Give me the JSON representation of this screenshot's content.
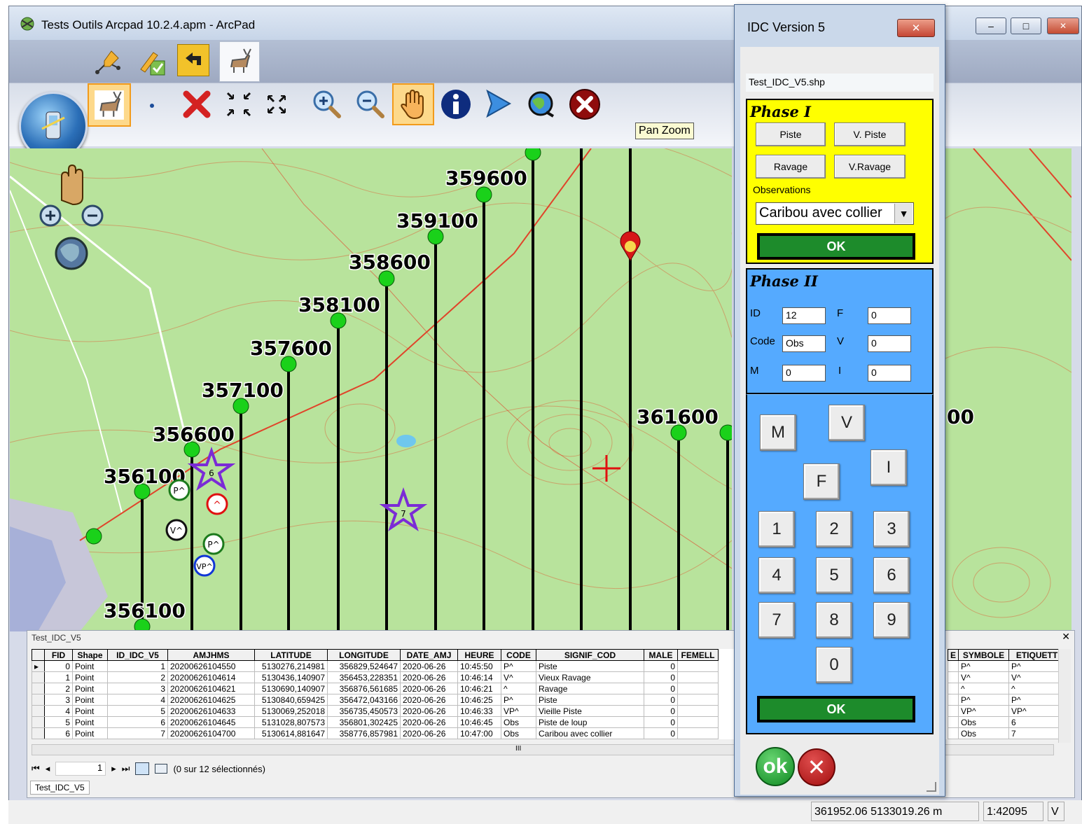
{
  "window": {
    "title": "Tests Outils Arcpad 10.2.4.apm - ArcPad",
    "minimize": "–",
    "maximize": "□",
    "close": "✕"
  },
  "toolbar": {
    "tooltip": "Pan Zoom",
    "active_tool_icon": "hand-pan-icon"
  },
  "map": {
    "grid_labels": [
      "359600",
      "359100",
      "358600",
      "358100",
      "357600",
      "357100",
      "356600",
      "356100",
      "356100",
      "361600",
      "00"
    ],
    "markers": [
      "P^",
      "^",
      "V^",
      "P^",
      "VP^",
      "6",
      "7"
    ]
  },
  "attribute_table": {
    "layer_name": "Test_IDC_V5",
    "close_label": "✕",
    "columns": [
      "FID",
      "Shape",
      "ID_IDC_V5",
      "AMJHMS",
      "LATITUDE",
      "LONGITUDE",
      "DATE_AMJ",
      "HEURE",
      "CODE",
      "SIGNIF_COD",
      "MALE",
      "FEMELL"
    ],
    "right_columns": [
      "E",
      "SYMBOLE",
      "ETIQUETT"
    ],
    "rows": [
      [
        "0",
        "Point",
        "1",
        "20200626104550",
        "5130276,214981",
        "356829,524647",
        "2020-06-26",
        "10:45:50",
        "P^",
        "Piste",
        "0",
        ""
      ],
      [
        "1",
        "Point",
        "2",
        "20200626104614",
        "5130436,140907",
        "356453,228351",
        "2020-06-26",
        "10:46:14",
        "V^",
        "Vieux Ravage",
        "0",
        ""
      ],
      [
        "2",
        "Point",
        "3",
        "20200626104621",
        "5130690,140907",
        "356876,561685",
        "2020-06-26",
        "10:46:21",
        "^",
        "Ravage",
        "0",
        ""
      ],
      [
        "3",
        "Point",
        "4",
        "20200626104625",
        "5130840,659425",
        "356472,043166",
        "2020-06-26",
        "10:46:25",
        "P^",
        "Piste",
        "0",
        ""
      ],
      [
        "4",
        "Point",
        "5",
        "20200626104633",
        "5130069,252018",
        "356735,450573",
        "2020-06-26",
        "10:46:33",
        "VP^",
        "Vieille Piste",
        "0",
        ""
      ],
      [
        "5",
        "Point",
        "6",
        "20200626104645",
        "5131028,807573",
        "356801,302425",
        "2020-06-26",
        "10:46:45",
        "Obs",
        "Piste de loup",
        "0",
        ""
      ],
      [
        "6",
        "Point",
        "7",
        "20200626104700",
        "5130614,881647",
        "358776,857981",
        "2020-06-26",
        "10:47:00",
        "Obs",
        "Caribou avec collier",
        "0",
        ""
      ]
    ],
    "right_rows": [
      [
        "P^",
        "P^"
      ],
      [
        "V^",
        "V^"
      ],
      [
        "^",
        "^"
      ],
      [
        "P^",
        "P^"
      ],
      [
        "VP^",
        "VP^"
      ],
      [
        "Obs",
        "6"
      ],
      [
        "Obs",
        "7"
      ]
    ],
    "record_number": "1",
    "selection_status": "(0 sur 12 sélectionnés)",
    "scroll_marker": "III",
    "tab_label": "Test_IDC_V5"
  },
  "status_bar": {
    "coordinates": "361952.06 5133019.26 m",
    "scale": "1:42095",
    "mode": "V"
  },
  "idc_dialog": {
    "title": "IDC Version 5",
    "close_label": "✕",
    "shapefile": "Test_IDC_V5.shp",
    "phase1": {
      "title": "Phase I",
      "btn_piste": "Piste",
      "btn_vpiste": "V. Piste",
      "btn_ravage": "Ravage",
      "btn_vravage": "V.Ravage",
      "observations_label": "Observations",
      "observations_value": "Caribou avec collier",
      "ok_label": "OK"
    },
    "phase2": {
      "title": "Phase II",
      "id_label": "ID",
      "id_value": "12",
      "f_label": "F",
      "f_value": "0",
      "code_label": "Code",
      "code_value": "Obs",
      "v_label": "V",
      "v_value": "0",
      "m_label": "M",
      "m_value": "0",
      "i_label": "I",
      "i_value": "0"
    },
    "keypad": {
      "m": "M",
      "v": "V",
      "i": "I",
      "f": "F",
      "k1": "1",
      "k2": "2",
      "k3": "3",
      "k4": "4",
      "k5": "5",
      "k6": "6",
      "k7": "7",
      "k8": "8",
      "k9": "9",
      "k0": "0",
      "ok_label": "OK"
    },
    "ok_round": "ok",
    "cancel_round": "✕"
  }
}
